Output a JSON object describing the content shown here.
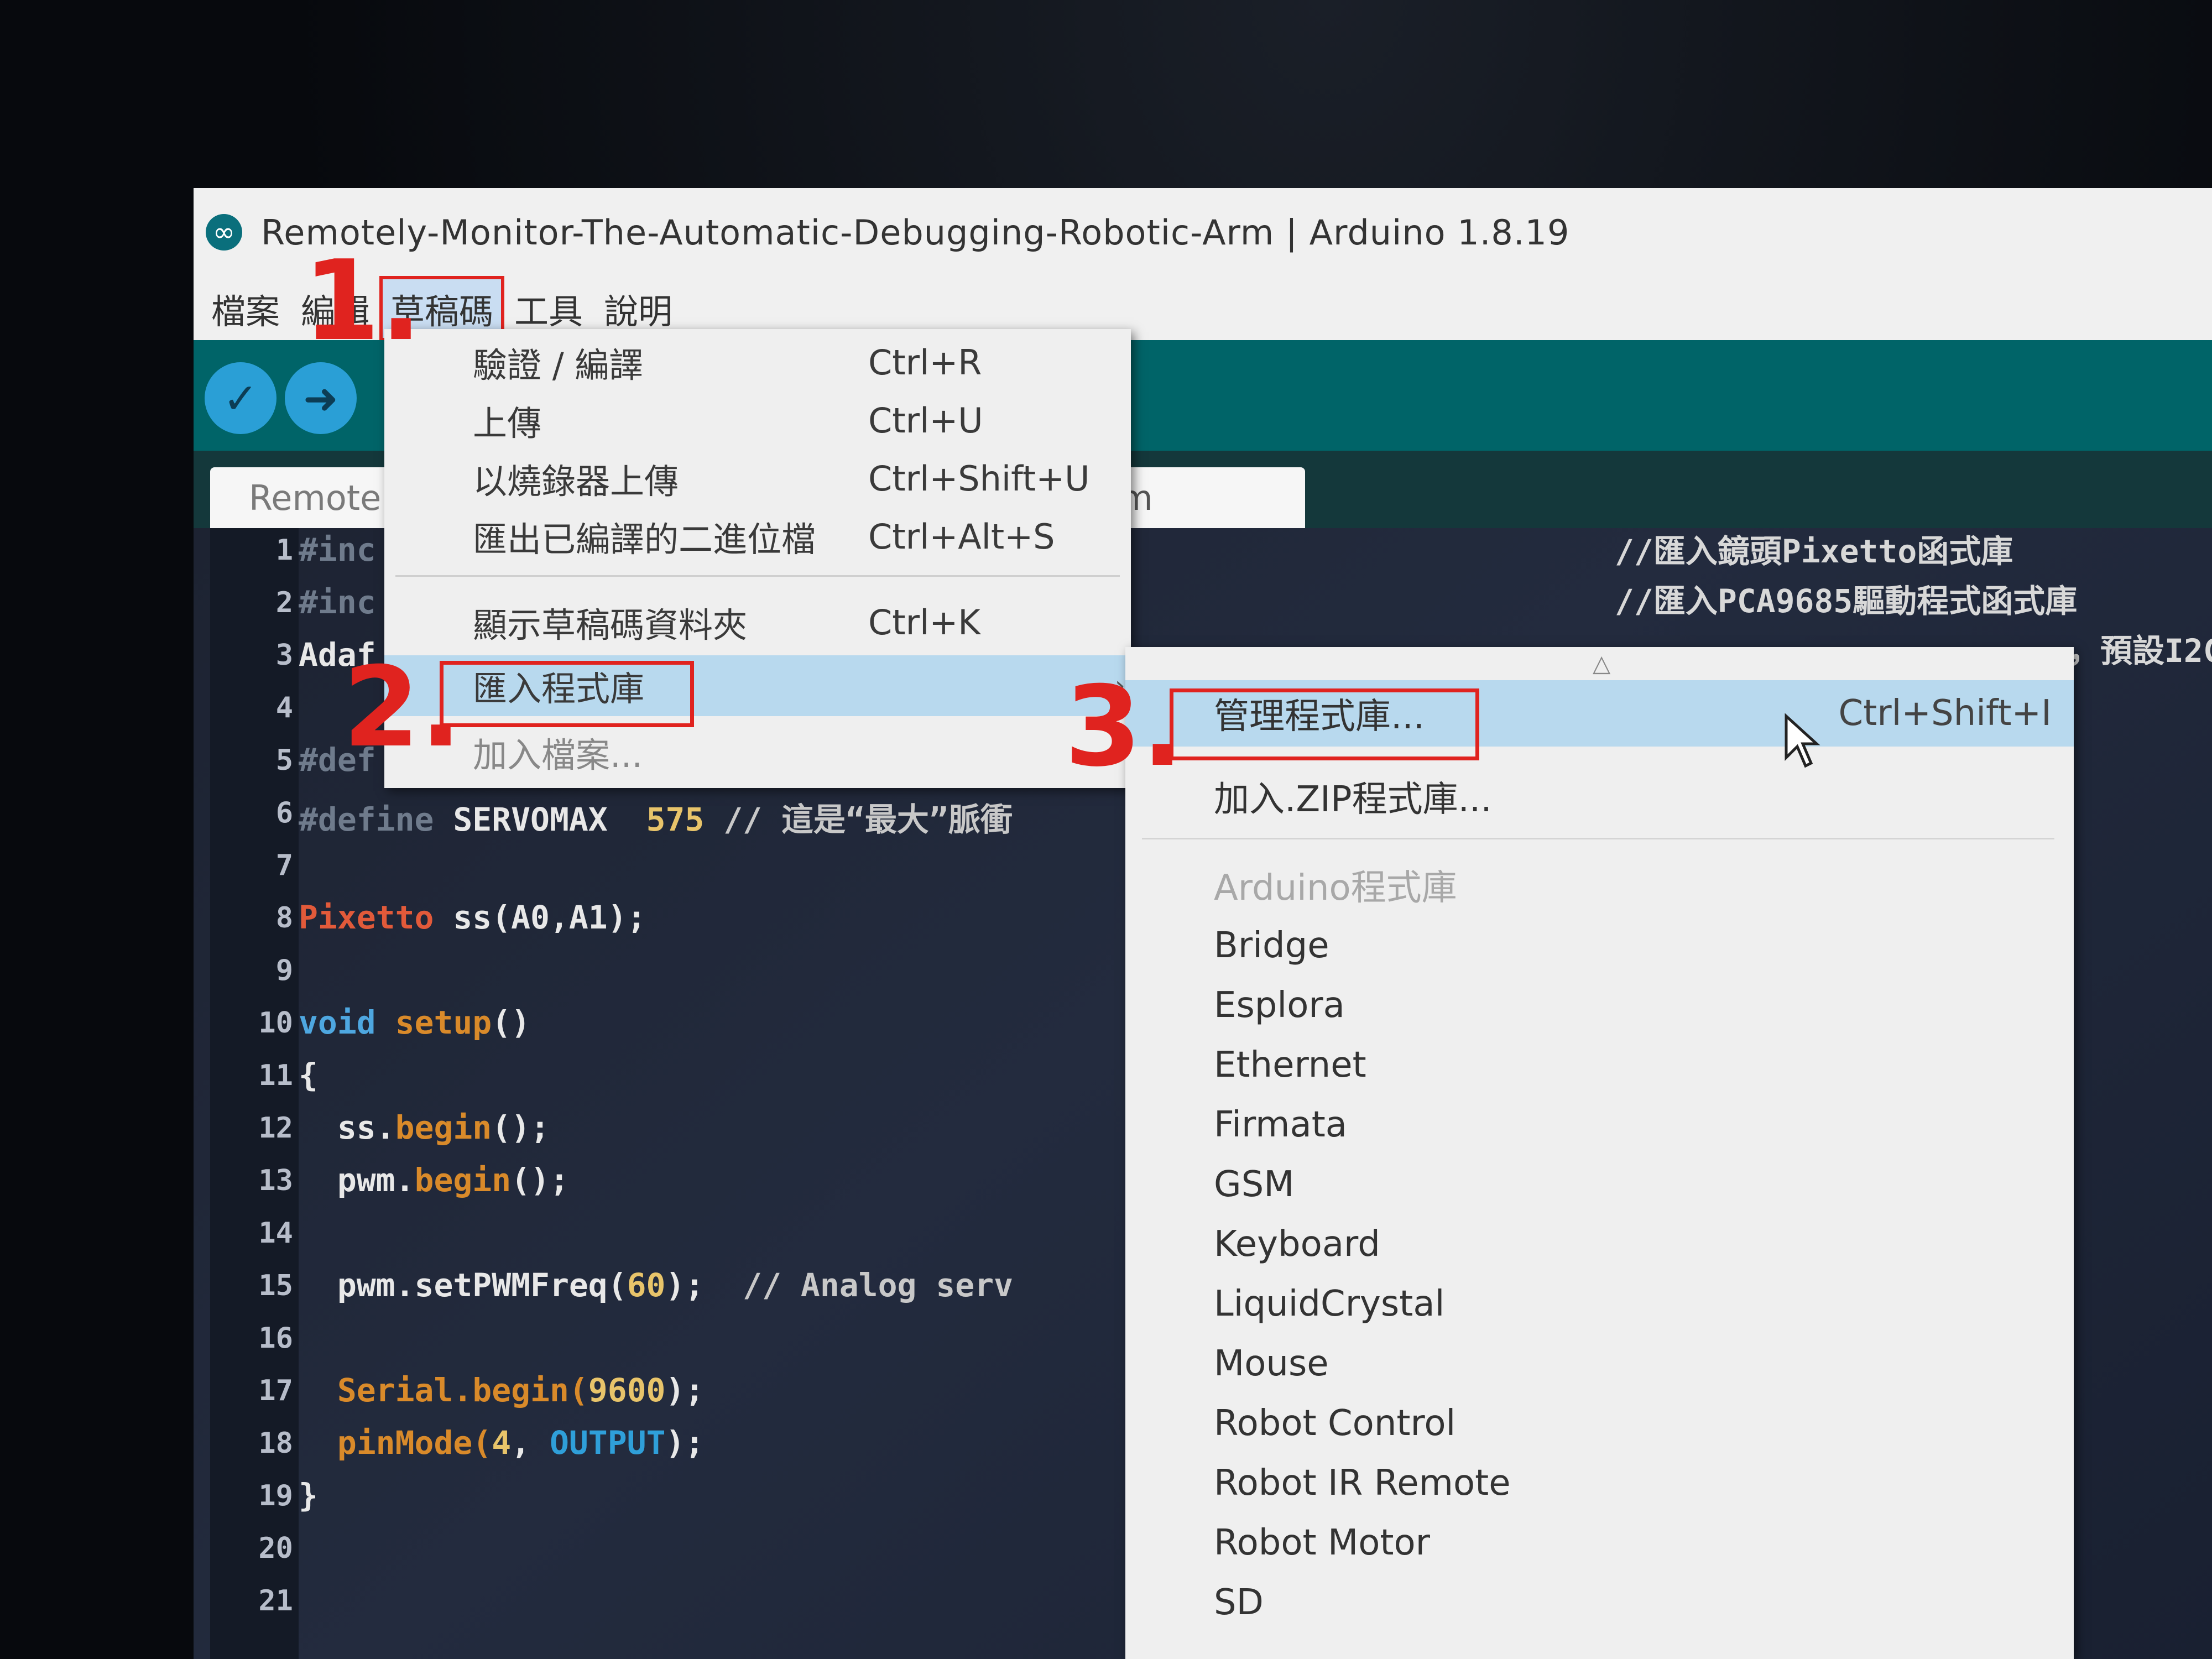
{
  "window": {
    "title": "Remotely-Monitor-The-Automatic-Debugging-Robotic-Arm | Arduino 1.8.19"
  },
  "menubar": {
    "items": [
      "檔案",
      "編輯",
      "草稿碼",
      "工具",
      "說明"
    ]
  },
  "toolbar": {
    "verify_icon": "checkmark-icon",
    "upload_icon": "arrow-right-icon"
  },
  "tabs": {
    "active_label": "Remotel",
    "second_label": "rm"
  },
  "sketch_menu": {
    "items": [
      {
        "label": "驗證 / 編譯",
        "shortcut": "Ctrl+R"
      },
      {
        "label": "上傳",
        "shortcut": "Ctrl+U"
      },
      {
        "label": "以燒錄器上傳",
        "shortcut": "Ctrl+Shift+U"
      },
      {
        "label": "匯出已編譯的二進位檔",
        "shortcut": "Ctrl+Alt+S"
      },
      {
        "label": "顯示草稿碼資料夾",
        "shortcut": "Ctrl+K"
      },
      {
        "label": "匯入程式庫",
        "shortcut": ""
      },
      {
        "label": "加入檔案...",
        "shortcut": ""
      }
    ]
  },
  "library_submenu": {
    "manage": {
      "label": "管理程式庫...",
      "shortcut": "Ctrl+Shift+I"
    },
    "add_zip": "加入.ZIP程式庫...",
    "section_header": "Arduino程式庫",
    "libraries": [
      "Bridge",
      "Esplora",
      "Ethernet",
      "Firmata",
      "GSM",
      "Keyboard",
      "LiquidCrystal",
      "Mouse",
      "Robot Control",
      "Robot IR Remote",
      "Robot Motor",
      "SD"
    ]
  },
  "editor": {
    "line_numbers": [
      "1",
      "2",
      "3",
      "4",
      "5",
      "6",
      "7",
      "8",
      "9",
      "10",
      "11",
      "12",
      "13",
      "14",
      "15",
      "16",
      "17",
      "18",
      "19",
      "20",
      "21"
    ],
    "line1": "#inc",
    "line2": "#inc",
    "line3": "Adaf",
    "line5": "#def",
    "line6_kw": "#define",
    "line6_name": "SERVOMAX",
    "line6_val": "575",
    "line6_comment": "// 這是“最大”脈衝",
    "line8_type": "Pixetto",
    "line8_rest": "ss(A0,A1);",
    "line10_kw": "void",
    "line10_fn": "setup",
    "line10_rest": "()",
    "line11": "{",
    "line12_obj": "ss.",
    "line12_fn": "begin",
    "line12_rest": "();",
    "line13_obj": "pwm.",
    "line13_fn": "begin",
    "line13_rest": "();",
    "line15_code": "pwm.setPWMFreq(",
    "line15_num": "60",
    "line15_end": ");",
    "line15_comment": "// Analog serv",
    "line17_fn": "Serial.begin(",
    "line17_num": "9600",
    "line17_end": ");",
    "line18_fn": "pinMode(",
    "line18_num": "4",
    "line18_sep": ", ",
    "line18_const": "OUTPUT",
    "line18_end": ");",
    "line19": "}",
    "comment_right_1": "//匯入鏡頭Pixetto函式庫",
    "comment_right_2": "//匯入PCA9685驅動程式函式庫",
    "comment_right_3": "，預設I2C"
  },
  "annotations": {
    "step1": "1.",
    "step2": "2.",
    "step3": "3."
  },
  "colors": {
    "highlight_box": "#e0231f",
    "menu_highlight": "#b8d9ee",
    "toolbar": "#006468"
  }
}
